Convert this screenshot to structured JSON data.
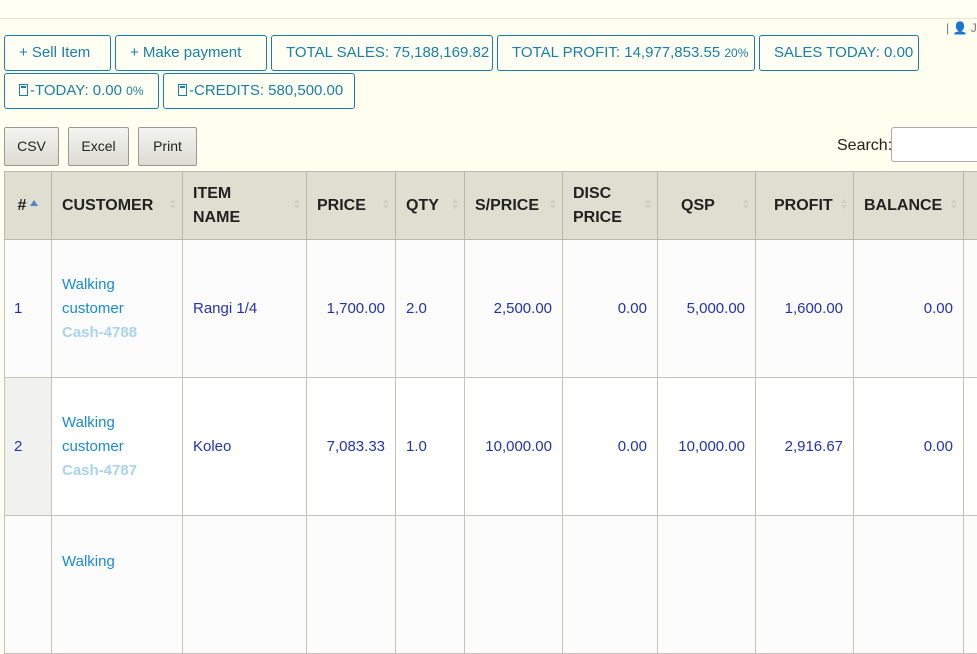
{
  "header": {
    "user_hint": "| 👤 Ja"
  },
  "buttons": {
    "sell_item": "+ Sell Item",
    "make_payment": "+ Make payment",
    "total_sales": "TOTAL SALES: 75,188,169.82",
    "total_profit": "TOTAL PROFIT: 14,977,853.55",
    "total_profit_pct": "20%",
    "sales_today": "SALES TODAY: 0.00",
    "today": "-TODAY: 0.00",
    "today_pct": "0%",
    "credits": "-CREDITS: 580,500.00"
  },
  "export": {
    "csv": "CSV",
    "excel": "Excel",
    "print": "Print"
  },
  "search": {
    "label": "Search:",
    "value": ""
  },
  "table": {
    "headers": {
      "num": "#",
      "customer": "CUSTOMER",
      "item_name": "ITEM NAME",
      "price": "PRICE",
      "qty": "QTY",
      "s_price": "S/PRICE",
      "disc_price": "DISC PRICE",
      "qsp": "QSP",
      "profit": "PROFIT",
      "balance": "BALANCE"
    },
    "rows": [
      {
        "num": "1",
        "customer": "Walking customer",
        "code": "Cash-4788",
        "item": "Rangi 1/4",
        "price": "1,700.00",
        "qty": "2.0",
        "s_price": "2,500.00",
        "disc_price": "0.00",
        "qsp": "5,000.00",
        "profit": "1,600.00",
        "balance": "0.00"
      },
      {
        "num": "2",
        "customer": "Walking customer",
        "code": "Cash-4787",
        "item": "Koleo",
        "price": "7,083.33",
        "qty": "1.0",
        "s_price": "10,000.00",
        "disc_price": "0.00",
        "qsp": "10,000.00",
        "profit": "2,916.67",
        "balance": "0.00"
      },
      {
        "num": "",
        "customer": "Walking",
        "code": "",
        "item": "",
        "price": "",
        "qty": "",
        "s_price": "",
        "disc_price": "",
        "qsp": "",
        "profit": "",
        "balance": ""
      }
    ]
  },
  "colors": {
    "accent": "#1a7fa6",
    "link": "#1a8ad4",
    "background": "#ffffef",
    "header_bg": "#dedfd0"
  }
}
